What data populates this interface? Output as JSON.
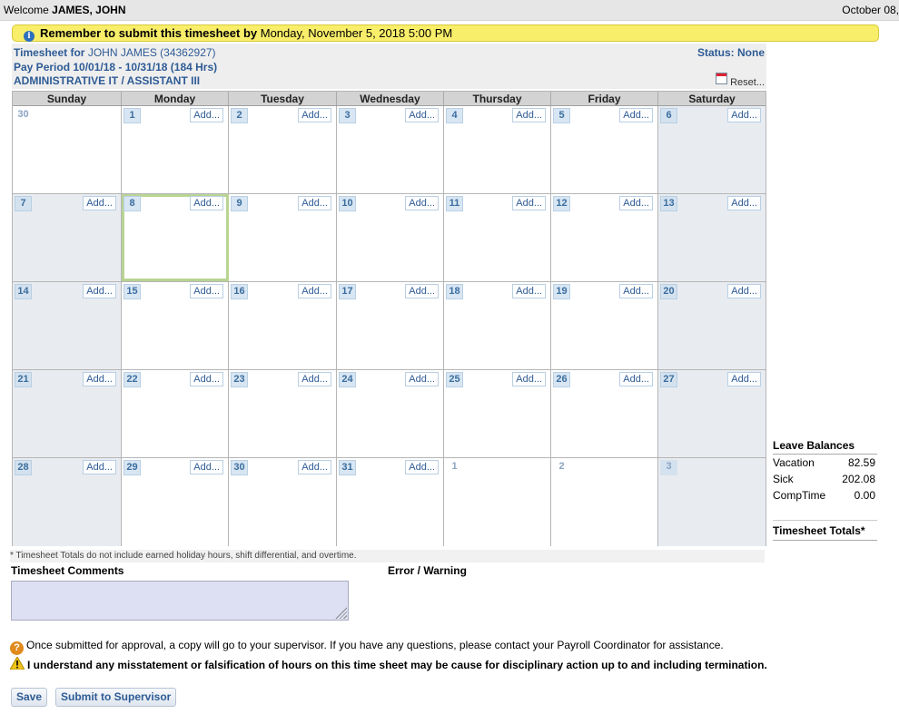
{
  "topbar": {
    "welcome_prefix": "Welcome ",
    "user": "JAMES, JOHN",
    "date": "October 08,"
  },
  "reminder": {
    "bold": "Remember to submit this timesheet by",
    "deadline": "Monday, November 5, 2018 5:00 PM"
  },
  "header": {
    "timesheet_for_label": "Timesheet for",
    "employee": "JOHN JAMES (34362927)",
    "pay_period": "Pay Period 10/01/18 - 10/31/18 (184 Hrs)",
    "department": "ADMINISTRATIVE IT / ASSISTANT III",
    "status": "Status: None",
    "reset": "Reset..."
  },
  "calendar": {
    "days_of_week": [
      "Sunday",
      "Monday",
      "Tuesday",
      "Wednesday",
      "Thursday",
      "Friday",
      "Saturday"
    ],
    "add_label": "Add...",
    "weeks": [
      [
        {
          "day": "30",
          "add": false
        },
        {
          "day": "1",
          "add": true
        },
        {
          "day": "2",
          "add": true
        },
        {
          "day": "3",
          "add": true
        },
        {
          "day": "4",
          "add": true
        },
        {
          "day": "5",
          "add": true
        },
        {
          "day": "6",
          "add": true
        }
      ],
      [
        {
          "day": "7",
          "add": true
        },
        {
          "day": "8",
          "add": true,
          "today": true
        },
        {
          "day": "9",
          "add": true
        },
        {
          "day": "10",
          "add": true
        },
        {
          "day": "11",
          "add": true
        },
        {
          "day": "12",
          "add": true
        },
        {
          "day": "13",
          "add": true
        }
      ],
      [
        {
          "day": "14",
          "add": true
        },
        {
          "day": "15",
          "add": true
        },
        {
          "day": "16",
          "add": true
        },
        {
          "day": "17",
          "add": true
        },
        {
          "day": "18",
          "add": true
        },
        {
          "day": "19",
          "add": true
        },
        {
          "day": "20",
          "add": true
        }
      ],
      [
        {
          "day": "21",
          "add": true
        },
        {
          "day": "22",
          "add": true
        },
        {
          "day": "23",
          "add": true
        },
        {
          "day": "24",
          "add": true
        },
        {
          "day": "25",
          "add": true
        },
        {
          "day": "26",
          "add": true
        },
        {
          "day": "27",
          "add": true
        }
      ],
      [
        {
          "day": "28",
          "add": true
        },
        {
          "day": "29",
          "add": true
        },
        {
          "day": "30",
          "add": true
        },
        {
          "day": "31",
          "add": true
        },
        {
          "day": "1",
          "add": false
        },
        {
          "day": "2",
          "add": false
        },
        {
          "day": "3",
          "add": false
        }
      ]
    ]
  },
  "leave_balances": {
    "title": "Leave Balances",
    "rows": [
      {
        "label": "Vacation",
        "value": "82.59"
      },
      {
        "label": "Sick",
        "value": "202.08"
      },
      {
        "label": "CompTime",
        "value": "0.00"
      }
    ]
  },
  "totals_title": "Timesheet Totals*",
  "footnote": "* Timesheet Totals do not include earned holiday hours, shift differential, and overtime.",
  "comments_label": "Timesheet Comments",
  "comments_value": "",
  "error_label": "Error / Warning",
  "notice_info": "Once submitted for approval, a copy will go to your supervisor. If you have any questions, please contact your Payroll Coordinator for assistance.",
  "notice_warning": "I understand any misstatement or falsification of hours on this time sheet may be cause for disciplinary action up to and including termination.",
  "buttons": {
    "save": "Save",
    "submit": "Submit to Supervisor"
  },
  "colors": {
    "link_blue": "#2e5b95",
    "reminder_yellow": "#f9ee6a",
    "today_outline": "#b9d493"
  }
}
